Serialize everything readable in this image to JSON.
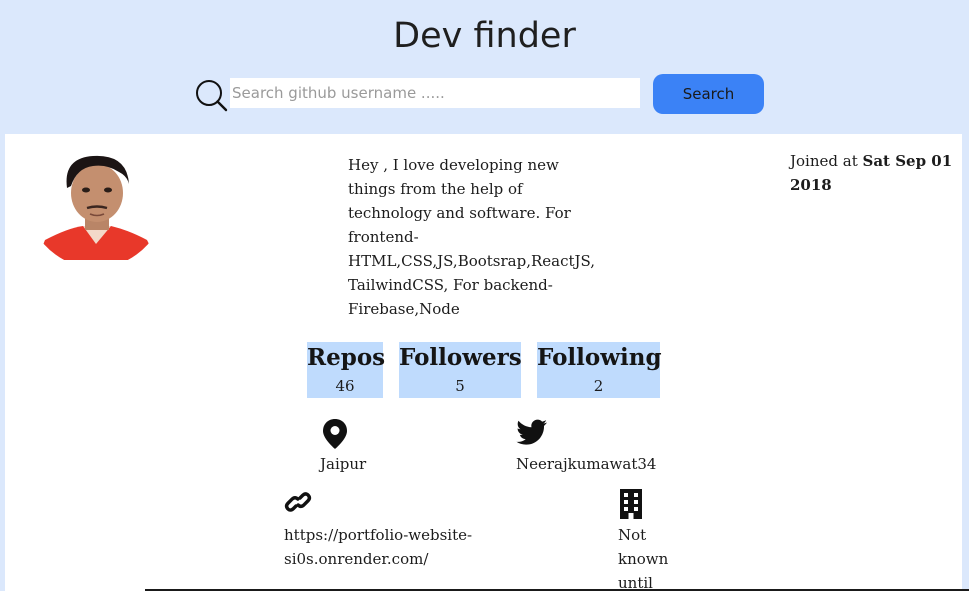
{
  "header": {
    "title": "Dev finder"
  },
  "search": {
    "placeholder": "Search github username .....",
    "value": "",
    "button_label": "Search"
  },
  "profile": {
    "bio": "Hey , I love developing new things from the help of technology and software. For frontend- HTML,CSS,JS,Bootsrap,ReactJS, TailwindCSS, For backend- Firebase,Node",
    "joined_prefix": "Joined at ",
    "joined_date": "Sat Sep 01 2018",
    "stats": [
      {
        "label": "Repos",
        "value": "46"
      },
      {
        "label": "Followers",
        "value": "5"
      },
      {
        "label": "Following",
        "value": "2"
      }
    ],
    "location": "Jaipur",
    "twitter": "Neerajkumawat34",
    "website": "https://portfolio-website-si0s.onrender.com/",
    "company": "Not known until"
  },
  "icons": {
    "search": "search-icon",
    "location": "map-pin-icon",
    "twitter": "twitter-icon",
    "website": "link-icon",
    "company": "building-icon"
  },
  "colors": {
    "background": "#dbe8fc",
    "accent": "#3b82f6",
    "stat_background": "#bfdbfd",
    "card": "#ffffff"
  }
}
